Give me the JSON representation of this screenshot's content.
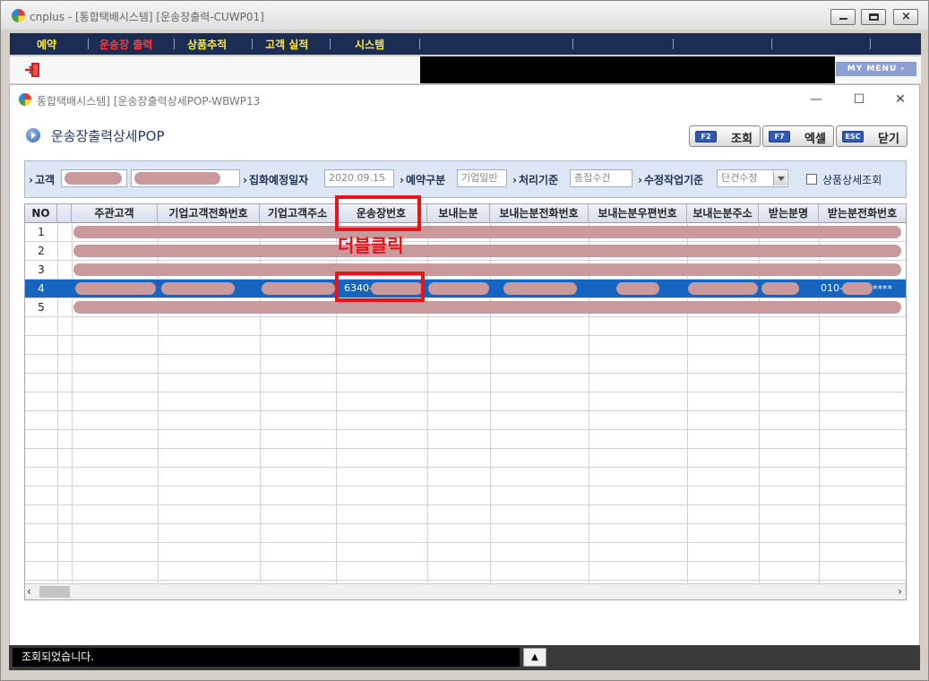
{
  "outer_window": {
    "title": "cnplus - [통합택배시스템] [운송장출력-CUWP01]",
    "buttons": {
      "minimize": "minimize",
      "maximize": "maximize",
      "close": "×"
    }
  },
  "menu": {
    "items": [
      {
        "label": "예약",
        "active": false
      },
      {
        "label": "운송장 출력",
        "active": true
      },
      {
        "label": "상품추적",
        "active": false
      },
      {
        "label": "고객 실적",
        "active": false
      },
      {
        "label": "시스템",
        "active": false
      }
    ],
    "my_menu_label": "MY MENU ›"
  },
  "popup": {
    "title": "통합택배시스템] [운송장출력상세POP-WBWP13",
    "win_min": "—",
    "win_max": "☐",
    "win_close": "✕",
    "page_title": "운송장출력상세POP",
    "buttons": [
      {
        "key": "F2",
        "label": "조회"
      },
      {
        "key": "F7",
        "label": "엑셀"
      },
      {
        "key": "ESC",
        "label": "닫기"
      }
    ]
  },
  "filters": {
    "customer_label": "고객",
    "pickup_date_label": "집화예정일자",
    "pickup_date_value": "2020.09.15",
    "reservation_type_label": "예약구분",
    "reservation_type_value": "기업일반",
    "process_basis_label": "처리기준",
    "process_basis_value": "총접수건",
    "edit_basis_label": "수정작업기준",
    "edit_basis_value": "단건수정",
    "detail_checkbox_label": "상품상세조회"
  },
  "grid": {
    "columns": [
      "NO",
      "주관고객",
      "기업고객전화번호",
      "기업고객주소",
      "운송장번호",
      "보내는분",
      "보내는분전화번호",
      "보내는분우편번호",
      "보내는분주소",
      "받는분명",
      "받는분전화번호"
    ],
    "rows": [
      {
        "no": "1"
      },
      {
        "no": "2"
      },
      {
        "no": "3"
      },
      {
        "no": "4",
        "waybill": "6340-",
        "receiver_phone": "010-",
        "receiver_phone_suffix": "****"
      },
      {
        "no": "5"
      }
    ],
    "selected_row": "4"
  },
  "annotation": {
    "text": "더블클릭",
    "color": "#e8141b"
  },
  "status": {
    "message": "조회되었습니다.",
    "button": "▲"
  },
  "colors": {
    "menu_bg": "#1b2d52",
    "menu_text": "#ffeb3b",
    "menu_active": "#ff3b3b",
    "selected_row": "#1565c0",
    "highlight": "#e8141b"
  }
}
